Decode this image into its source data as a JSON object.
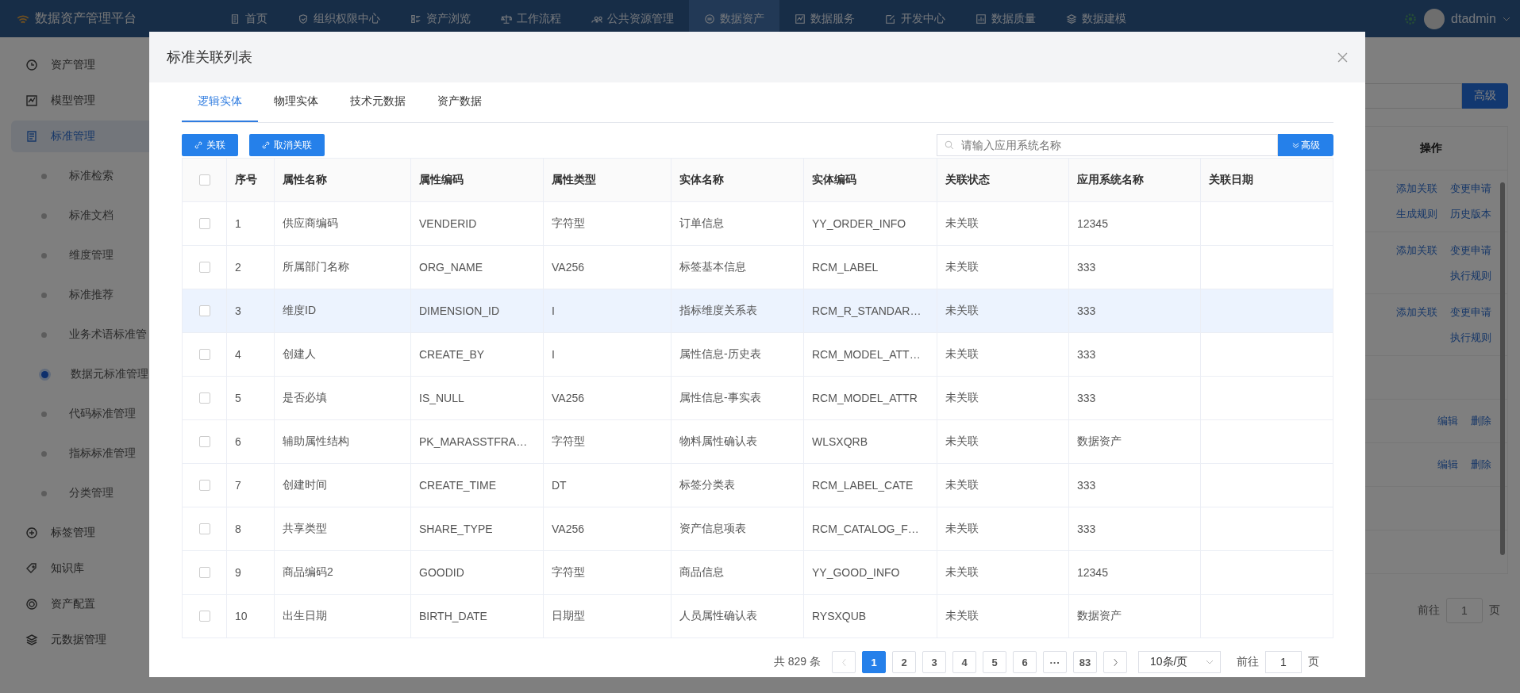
{
  "nav": {
    "logo": "数据资产管理平台",
    "user": "dtadmin",
    "items": [
      {
        "label": "首页",
        "selected": false
      },
      {
        "label": "组织权限中心",
        "selected": false
      },
      {
        "label": "资产浏览",
        "selected": false
      },
      {
        "label": "工作流程",
        "selected": false
      },
      {
        "label": "公共资源管理",
        "selected": false
      },
      {
        "label": "数据资产",
        "selected": true
      },
      {
        "label": "数据服务",
        "selected": false
      },
      {
        "label": "开发中心",
        "selected": false
      },
      {
        "label": "数据质量",
        "selected": false
      },
      {
        "label": "数据建模",
        "selected": false
      }
    ]
  },
  "sidebar": {
    "items": [
      {
        "label": "资产管理",
        "selected": false
      },
      {
        "label": "模型管理",
        "selected": false
      },
      {
        "label": "标准管理",
        "selected": true,
        "children": [
          {
            "label": "标准检索",
            "selected": false
          },
          {
            "label": "标准文档",
            "selected": false
          },
          {
            "label": "维度管理",
            "selected": false
          },
          {
            "label": "标准推荐",
            "selected": false
          },
          {
            "label": "业务术语标准管",
            "selected": false
          },
          {
            "label": "数据元标准管理",
            "selected": true
          },
          {
            "label": "代码标准管理",
            "selected": false
          },
          {
            "label": "指标标准管理",
            "selected": false
          },
          {
            "label": "分类管理",
            "selected": false
          }
        ]
      },
      {
        "label": "标签管理",
        "selected": false
      },
      {
        "label": "知识库",
        "selected": false
      },
      {
        "label": "资产配置",
        "selected": false
      },
      {
        "label": "元数据管理",
        "selected": false
      }
    ]
  },
  "background": {
    "advanced_button": "高级",
    "column": "操作",
    "rows": [
      {
        "actions": [
          [
            "添加关联",
            "变更申请"
          ],
          [
            "生成规则",
            "历史版本"
          ]
        ]
      },
      {
        "actions": [
          [
            "添加关联",
            "变更申请"
          ],
          [
            "执行规则"
          ]
        ]
      },
      {
        "actions": [
          [
            "添加关联",
            "变更申请"
          ],
          [
            "执行规则"
          ]
        ]
      },
      {
        "actions": []
      },
      {
        "actions": [
          [
            "编辑",
            "删除"
          ]
        ]
      },
      {
        "actions": [
          [
            "编辑",
            "删除"
          ]
        ]
      },
      {
        "actions": []
      },
      {
        "actions": []
      }
    ],
    "pagination": {
      "goto_label": "前往",
      "page": "1",
      "suffix": "页"
    }
  },
  "dialog": {
    "title": "标准关联列表",
    "tabs": [
      {
        "label": "逻辑实体",
        "selected": true
      },
      {
        "label": "物理实体",
        "selected": false
      },
      {
        "label": "技术元数据",
        "selected": false
      },
      {
        "label": "资产数据",
        "selected": false
      }
    ],
    "buttons": [
      "关联",
      "取消关联"
    ],
    "search": {
      "placeholder": "请输入应用系统名称"
    },
    "advanced_button": "高级",
    "all_checked": false,
    "columns": [
      "序号",
      "属性名称",
      "属性编码",
      "属性类型",
      "实体名称",
      "实体编码",
      "关联状态",
      "应用系统名称",
      "关联日期"
    ],
    "rows": [
      {
        "checked": false,
        "highlighted": false,
        "cells": [
          "1",
          "供应商编码",
          "VENDERID",
          "字符型",
          "订单信息",
          "YY_ORDER_INFO",
          "未关联",
          "12345"
        ]
      },
      {
        "checked": false,
        "highlighted": false,
        "cells": [
          "2",
          "所属部门名称",
          "ORG_NAME",
          "VA256",
          "标签基本信息",
          "RCM_LABEL",
          "未关联",
          "333"
        ]
      },
      {
        "checked": false,
        "highlighted": true,
        "cells": [
          "3",
          "维度ID",
          "DIMENSION_ID",
          "I",
          "指标维度关系表",
          "RCM_R_STANDAR…",
          "未关联",
          "333"
        ]
      },
      {
        "checked": false,
        "highlighted": false,
        "cells": [
          "4",
          "创建人",
          "CREATE_BY",
          "I",
          "属性信息-历史表",
          "RCM_MODEL_ATT…",
          "未关联",
          "333"
        ]
      },
      {
        "checked": false,
        "highlighted": false,
        "cells": [
          "5",
          "是否必填",
          "IS_NULL",
          "VA256",
          "属性信息-事实表",
          "RCM_MODEL_ATTR",
          "未关联",
          "333"
        ]
      },
      {
        "checked": false,
        "highlighted": false,
        "cells": [
          "6",
          "辅助属性结构",
          "PK_MARASSTFRA…",
          "字符型",
          "物料属性确认表",
          "WLSXQRB",
          "未关联",
          "数据资产"
        ]
      },
      {
        "checked": false,
        "highlighted": false,
        "cells": [
          "7",
          "创建时间",
          "CREATE_TIME",
          "DT",
          "标签分类表",
          "RCM_LABEL_CATE",
          "未关联",
          "333"
        ]
      },
      {
        "checked": false,
        "highlighted": false,
        "cells": [
          "8",
          "共享类型",
          "SHARE_TYPE",
          "VA256",
          "资产信息项表",
          "RCM_CATALOG_F…",
          "未关联",
          "333"
        ]
      },
      {
        "checked": false,
        "highlighted": false,
        "cells": [
          "9",
          "商品编码2",
          "GOODID",
          "字符型",
          "商品信息",
          "YY_GOOD_INFO",
          "未关联",
          "12345"
        ]
      },
      {
        "checked": false,
        "highlighted": false,
        "cells": [
          "10",
          "出生日期",
          "BIRTH_DATE",
          "日期型",
          "人员属性确认表",
          "RYSXQUB",
          "未关联",
          "数据资产"
        ]
      }
    ],
    "pagination": {
      "total": "共 829 条",
      "prev_disabled": true,
      "pages": [
        {
          "label": "1",
          "selected": true
        },
        {
          "label": "2",
          "selected": false
        },
        {
          "label": "3",
          "selected": false
        },
        {
          "label": "4",
          "selected": false
        },
        {
          "label": "5",
          "selected": false
        },
        {
          "label": "6",
          "selected": false
        },
        {
          "label": "···",
          "selected": false
        },
        {
          "label": "83",
          "selected": false
        }
      ],
      "page_size": "10条/页",
      "goto_label": "前往",
      "page": "1",
      "suffix": "页"
    }
  }
}
